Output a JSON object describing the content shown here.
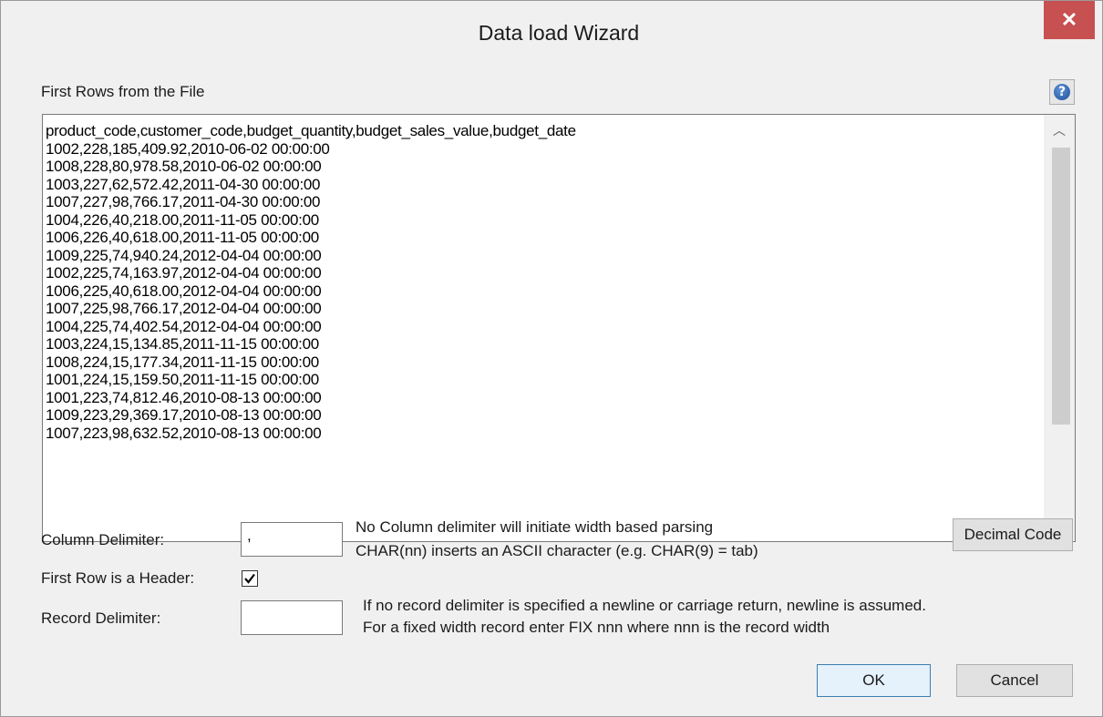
{
  "window": {
    "title": "Data load Wizard",
    "close_glyph": "✕"
  },
  "preview": {
    "label": "First Rows from the File",
    "lines": [
      "product_code,customer_code,budget_quantity,budget_sales_value,budget_date",
      "1002,228,185,409.92,2010-06-02 00:00:00",
      "1008,228,80,978.58,2010-06-02 00:00:00",
      "1003,227,62,572.42,2011-04-30 00:00:00",
      "1007,227,98,766.17,2011-04-30 00:00:00",
      "1004,226,40,218.00,2011-11-05 00:00:00",
      "1006,226,40,618.00,2011-11-05 00:00:00",
      "1009,225,74,940.24,2012-04-04 00:00:00",
      "1002,225,74,163.97,2012-04-04 00:00:00",
      "1006,225,40,618.00,2012-04-04 00:00:00",
      "1007,225,98,766.17,2012-04-04 00:00:00",
      "1004,225,74,402.54,2012-04-04 00:00:00",
      "1003,224,15,134.85,2011-11-15 00:00:00",
      "1008,224,15,177.34,2011-11-15 00:00:00",
      "1001,224,15,159.50,2011-11-15 00:00:00",
      "1001,223,74,812.46,2010-08-13 00:00:00",
      "1009,223,29,369.17,2010-08-13 00:00:00",
      "1007,223,98,632.52,2010-08-13 00:00:00"
    ],
    "scroll_up_glyph": "︿",
    "scroll_down_glyph": "﹀"
  },
  "help": {
    "glyph": "?"
  },
  "column_delimiter": {
    "label": "Column Delimiter:",
    "value": ",",
    "hint_1": "No Column delimiter will initiate width based parsing",
    "hint_2": "CHAR(nn) inserts an ASCII character (e.g. CHAR(9) = tab)"
  },
  "decimal_code_button": "Decimal Code",
  "header_row": {
    "label": "First Row is a Header:",
    "checked": true
  },
  "record_delimiter": {
    "label": "Record Delimiter:",
    "value": "",
    "hint_1": "If no record delimiter is specified a newline or carriage return, newline is assumed.",
    "hint_2": "For a fixed width record enter FIX nnn where nnn is the record width"
  },
  "buttons": {
    "ok": "OK",
    "cancel": "Cancel"
  }
}
